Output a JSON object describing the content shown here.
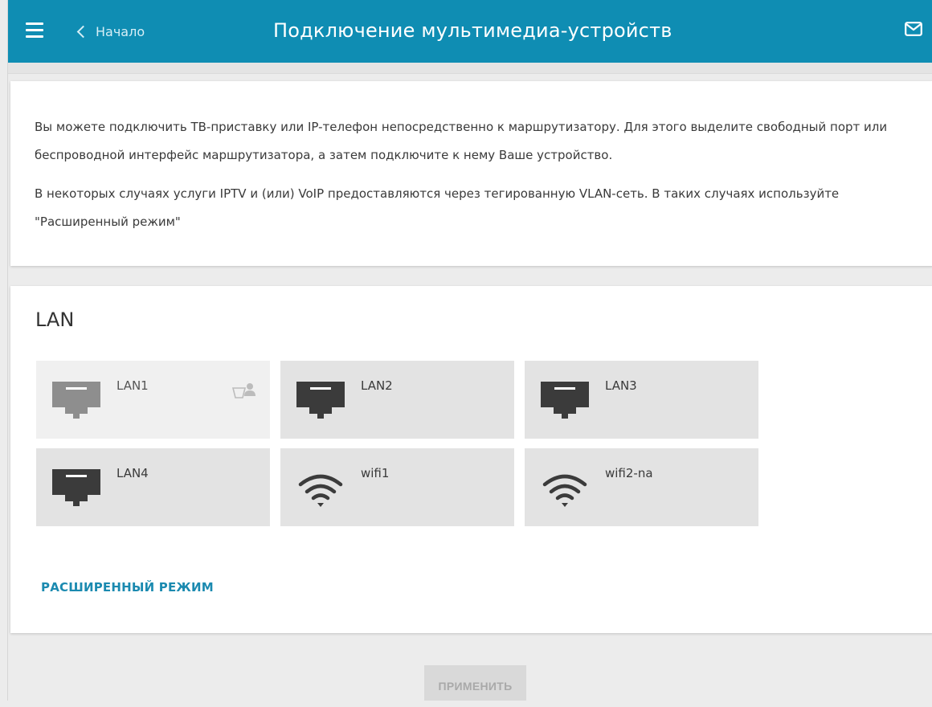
{
  "header": {
    "back_label": "Начало",
    "title": "Подключение мультимедиа-устройств",
    "menu_icon": "hamburger-menu-icon",
    "mail_icon": "envelope-icon",
    "background_color": "#0f8db3"
  },
  "info": {
    "paragraph1": "Вы можете подключить ТВ-приставку или IP-телефон непосредственно к маршрутизатору. Для этого выделите свободный порт или беспроводной интерфейс маршрутизатора, а затем подключите к нему Ваше устройство.",
    "paragraph2": "В некоторых случаях услуги IPTV и (или) VoIP предоставляются через тегированную VLAN-сеть. В таких случаях используйте \"Расширенный режим\""
  },
  "lan": {
    "title": "LAN",
    "interfaces": [
      {
        "label": "LAN1",
        "type": "ethernet",
        "state": "in-use",
        "icon": "ethernet-port-icon",
        "badge_icon": "connected-user-icon"
      },
      {
        "label": "LAN2",
        "type": "ethernet",
        "state": "free",
        "icon": "ethernet-port-icon"
      },
      {
        "label": "LAN3",
        "type": "ethernet",
        "state": "free",
        "icon": "ethernet-port-icon"
      },
      {
        "label": "LAN4",
        "type": "ethernet",
        "state": "free",
        "icon": "ethernet-port-icon"
      },
      {
        "label": "wifi1",
        "type": "wireless",
        "state": "free",
        "icon": "wifi-icon"
      },
      {
        "label": "wifi2-na",
        "type": "wireless",
        "state": "free",
        "icon": "wifi-icon"
      }
    ],
    "advanced_link": "РАСШИРЕННЫЙ РЕЖИМ",
    "link_color": "#1b8ab0"
  },
  "footer": {
    "apply_label": "ПРИМЕНИТЬ",
    "apply_enabled": false
  }
}
